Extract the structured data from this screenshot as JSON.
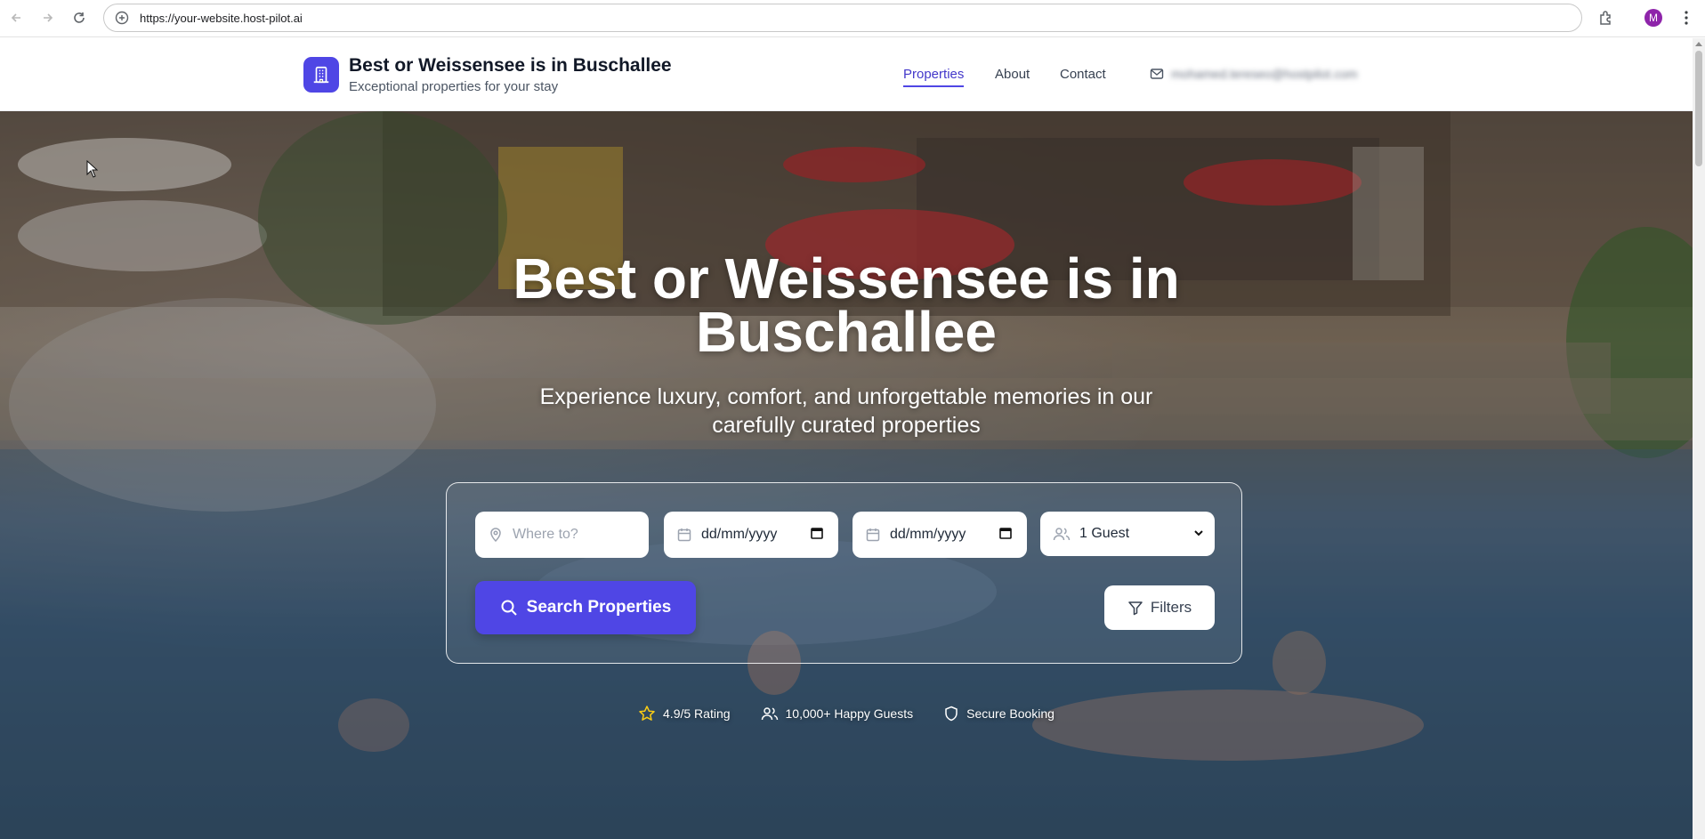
{
  "browser": {
    "url": "https://your-website.host-pilot.ai",
    "profile_initial": "M"
  },
  "header": {
    "brand_title": "Best or Weissensee is in Buschallee",
    "brand_subtitle": "Exceptional properties for your stay",
    "nav": [
      {
        "label": "Properties",
        "active": true
      },
      {
        "label": "About",
        "active": false
      },
      {
        "label": "Contact",
        "active": false
      }
    ],
    "email": "mohamed.tereseo@hostpilot.com"
  },
  "hero": {
    "title_line1": "Best or Weissensee is in",
    "title_line2": "Buschallee",
    "subtitle_line1": "Experience luxury, comfort, and unforgettable memories in our",
    "subtitle_line2": "carefully curated properties"
  },
  "search": {
    "location_placeholder": "Where to?",
    "checkin_value": "dd/mm/yyyy",
    "checkout_value": "dd/mm/yyyy",
    "guests_value": "1 Guest",
    "search_button": "Search Properties",
    "filters_button": "Filters"
  },
  "stats": {
    "rating": "4.9/5 Rating",
    "guests": "10,000+ Happy Guests",
    "secure": "Secure Booking"
  },
  "colors": {
    "accent": "#4f46e5",
    "nav_active": "#4338ca"
  }
}
